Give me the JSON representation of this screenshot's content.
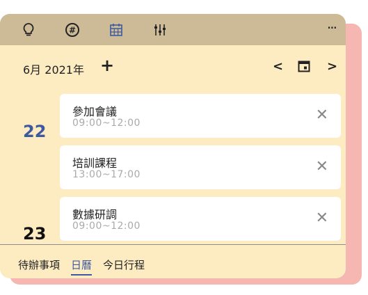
{
  "colors": {
    "toolbar_bg": "#cdbb98",
    "widget_bg": "#fdebc2",
    "shadow_bg": "#f6b6b2",
    "accent": "#3d5aa0"
  },
  "toolbar": {
    "icons": [
      "lightbulb-icon",
      "hashtag-icon",
      "calendar-grid-icon",
      "sliders-icon"
    ],
    "more": "···"
  },
  "month_bar": {
    "label": "6月 2021年",
    "add": "+",
    "prev": "<",
    "next": ">"
  },
  "days": [
    {
      "day": "22",
      "day_color": "#3d5aa0",
      "events": [
        {
          "title": "參加會議",
          "time": "09:00~12:00"
        },
        {
          "title": "培訓課程",
          "time": "13:00~17:00"
        }
      ]
    },
    {
      "day": "23",
      "day_color": "#111111",
      "events": [
        {
          "title": "數據研調",
          "time": "09:00~12:00"
        }
      ]
    }
  ],
  "close_symbol": "✕",
  "tabs": [
    {
      "label": "待辦事項",
      "active": false
    },
    {
      "label": "日曆",
      "active": true
    },
    {
      "label": "今日行程",
      "active": false
    }
  ]
}
